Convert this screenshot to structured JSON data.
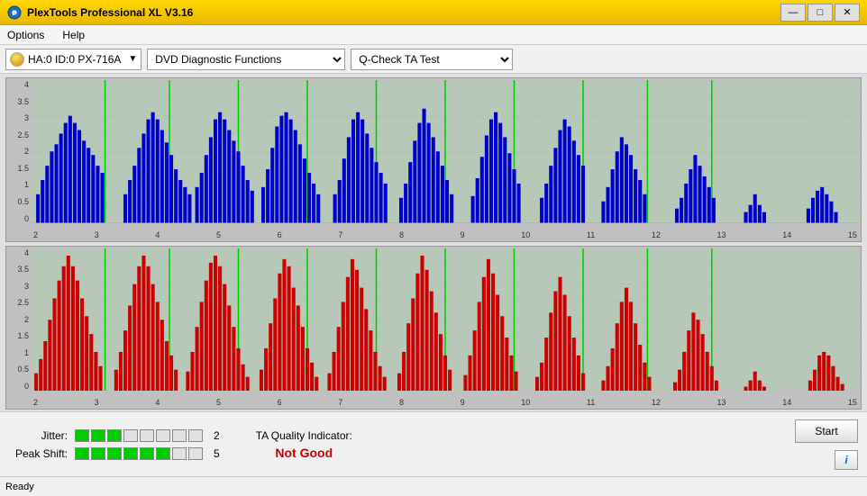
{
  "titleBar": {
    "title": "PlexTools Professional XL V3.16",
    "minimizeLabel": "—",
    "maximizeLabel": "□",
    "closeLabel": "✕"
  },
  "menuBar": {
    "items": [
      "Options",
      "Help"
    ]
  },
  "toolbar": {
    "deviceLabel": "HA:0 ID:0  PX-716A",
    "functionLabel": "DVD Diagnostic Functions",
    "testLabel": "Q-Check TA Test"
  },
  "charts": [
    {
      "id": "top-chart",
      "color": "blue",
      "yLabels": [
        "4",
        "3.5",
        "3",
        "2.5",
        "2",
        "1.5",
        "1",
        "0.5",
        "0"
      ],
      "xLabels": [
        "2",
        "3",
        "4",
        "5",
        "6",
        "7",
        "8",
        "9",
        "10",
        "11",
        "12",
        "13",
        "14",
        "15"
      ]
    },
    {
      "id": "bottom-chart",
      "color": "red",
      "yLabels": [
        "4",
        "3.5",
        "3",
        "2.5",
        "2",
        "1.5",
        "1",
        "0.5",
        "0"
      ],
      "xLabels": [
        "2",
        "3",
        "4",
        "5",
        "6",
        "7",
        "8",
        "9",
        "10",
        "11",
        "12",
        "13",
        "14",
        "15"
      ]
    }
  ],
  "indicators": {
    "jitter": {
      "label": "Jitter:",
      "greenBars": 3,
      "emptyBars": 5,
      "value": "2"
    },
    "peakShift": {
      "label": "Peak Shift:",
      "greenBars": 6,
      "emptyBars": 2,
      "value": "5"
    },
    "taQuality": {
      "label": "TA Quality Indicator:",
      "value": "Not Good",
      "color": "#cc0000"
    }
  },
  "buttons": {
    "start": "Start",
    "info": "i"
  },
  "statusBar": {
    "text": "Ready"
  }
}
